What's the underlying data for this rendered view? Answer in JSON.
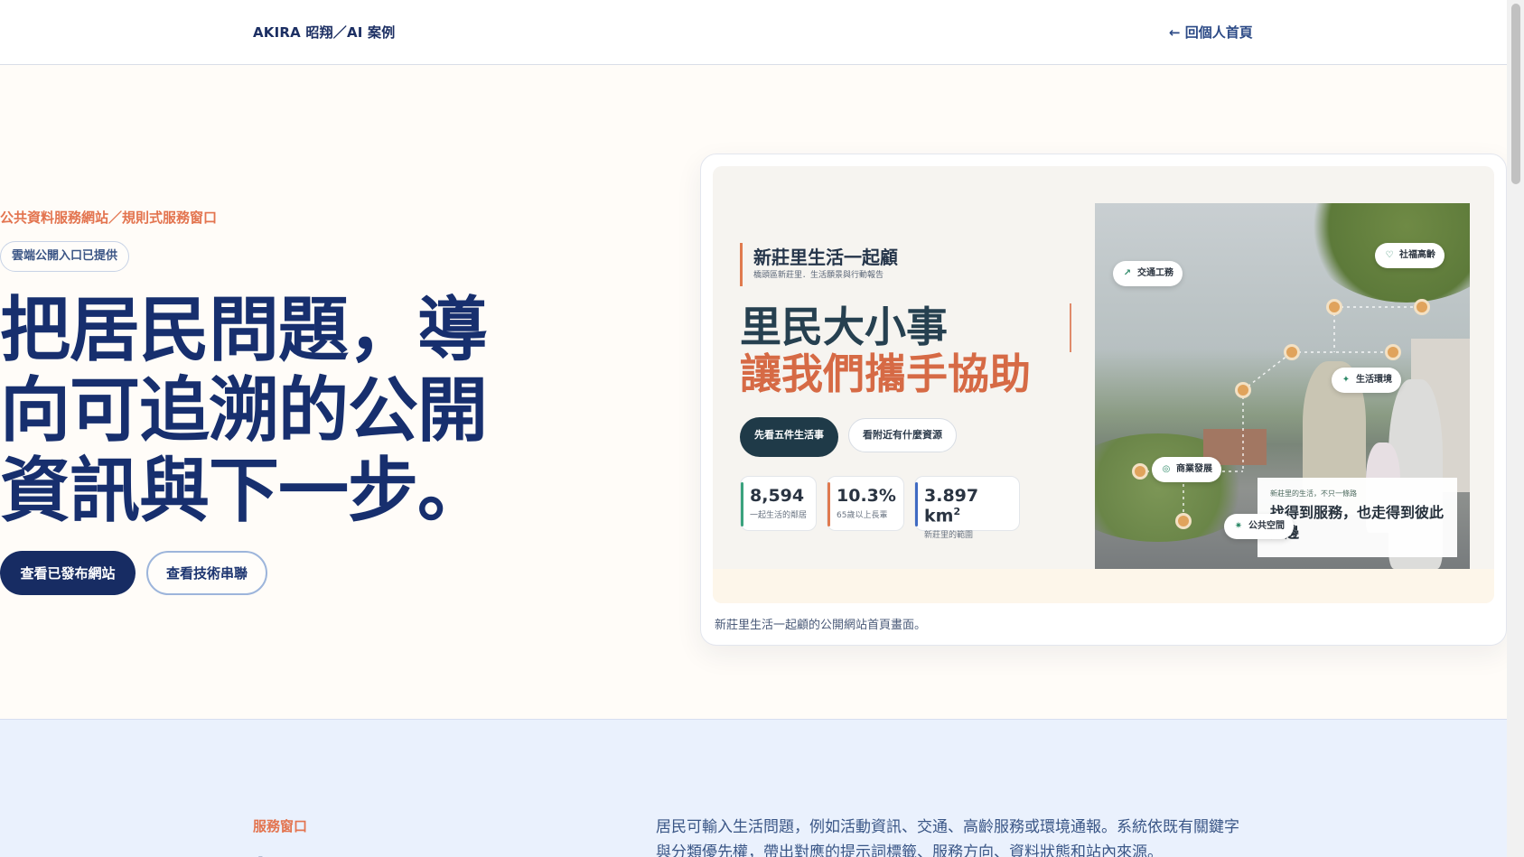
{
  "header": {
    "brand": "AKIRA 昭翔／AI 案例",
    "back_link": "← 回個人首頁"
  },
  "hero": {
    "eyebrow": "公共資料服務網站／規則式服務窗口",
    "pill": "雲端公開入口已提供",
    "title": "把居民問題，導向可追溯的公開資訊與下一步。",
    "primary_button": "查看已發布網站",
    "secondary_button": "查看技術串聯"
  },
  "preview": {
    "caption": "新莊里生活一起顧的公開網站首頁畫面。",
    "site_title": "新莊里生活一起顧",
    "site_subtitle": "橋頭區新莊里．生活願景與行動報告",
    "headline_1": "里民大小事",
    "headline_2": "讓我們攜手協助",
    "button_1": "先看五件生活事",
    "button_2": "看附近有什麼資源",
    "stats": [
      {
        "value": "8,594",
        "label": "一起生活的鄰居"
      },
      {
        "value": "10.3%",
        "label": "65歲以上長輩"
      },
      {
        "value": "3.897 km",
        "sup": "2",
        "label": "新莊里的範圍"
      }
    ],
    "tags": {
      "traffic": "交通工務",
      "welfare": "社福高齡",
      "environment": "生活環境",
      "commerce": "商業發展",
      "public_space": "公共空間"
    },
    "overlay_small": "新莊里的生活，不只一條路",
    "overlay_big": "找得到服務，也走得到彼此身邊"
  },
  "service": {
    "eyebrow": "服務窗口",
    "title_cut": "把居民問題",
    "description": "居民可輸入生活問題，例如活動資訊、交通、高齡服務或環境通報。系統依既有關鍵字與分類優先權，帶出對應的提示詞標籤、服務方向、資料狀態和站內來源。"
  }
}
